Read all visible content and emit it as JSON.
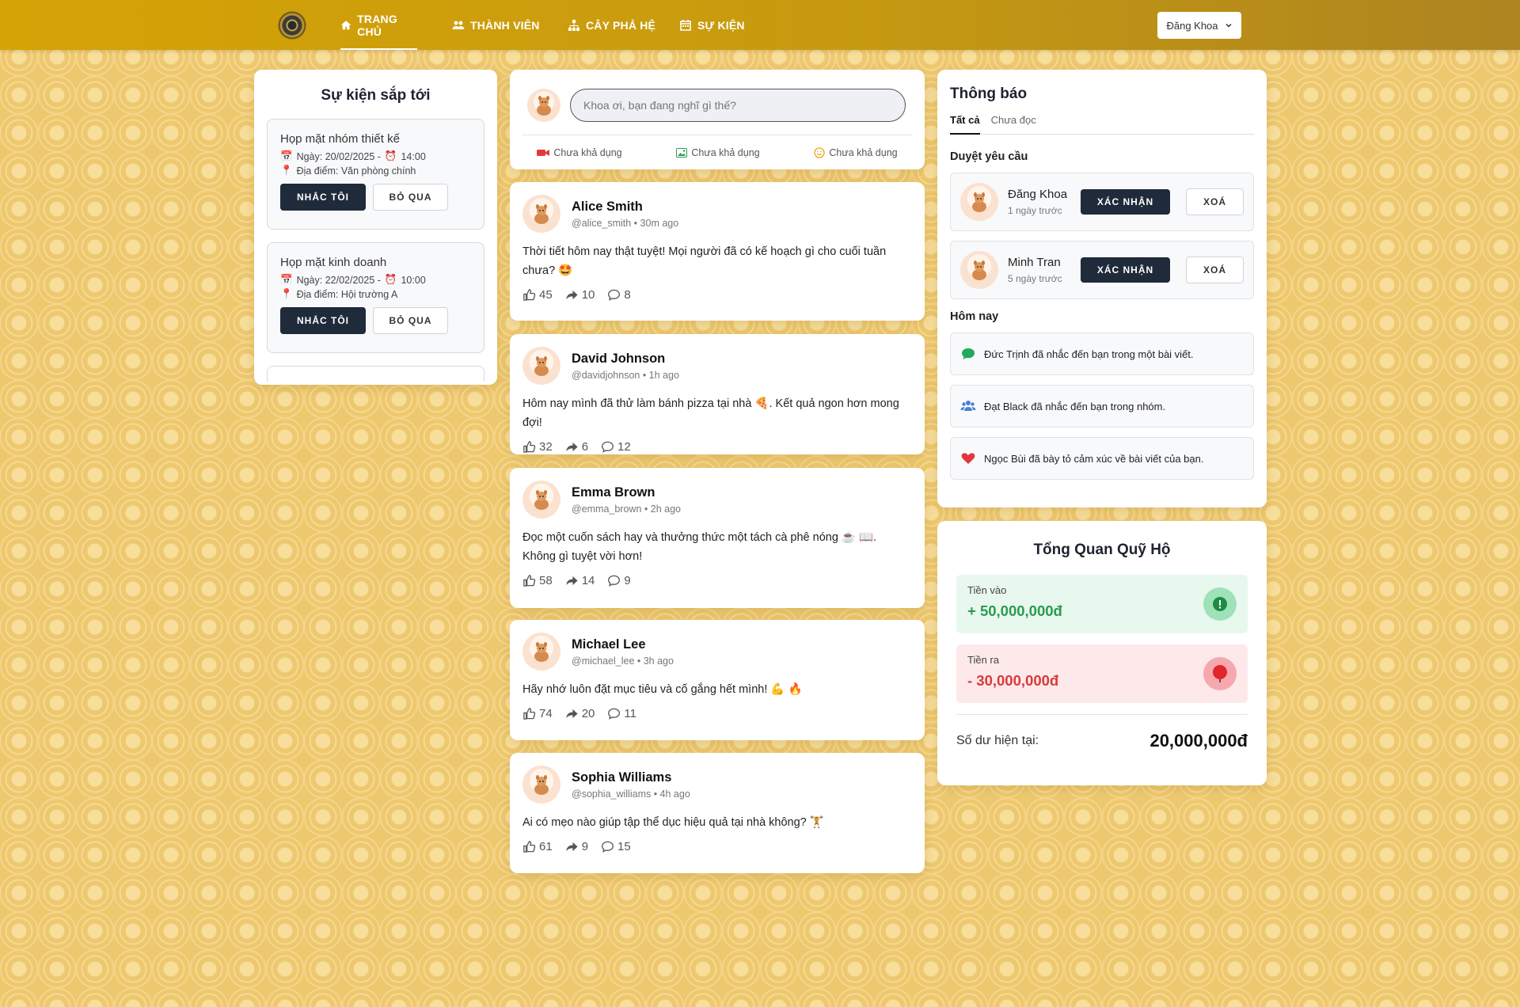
{
  "nav": {
    "items": [
      {
        "label": "TRANG CHỦ",
        "icon": "home-icon"
      },
      {
        "label": "THÀNH VIÊN",
        "icon": "users-icon"
      },
      {
        "label": "CÂY PHẢ HỆ",
        "icon": "sitemap-icon"
      },
      {
        "label": "SỰ KIỆN",
        "icon": "calendar-icon"
      }
    ],
    "user": "Đăng Khoa"
  },
  "events": {
    "title": "Sự kiện sắp tới",
    "items": [
      {
        "title": "Họp mặt nhóm thiết kế",
        "date": "Ngày: 20/02/2025 -",
        "time": "14:00",
        "location": "Địa điểm: Văn phòng chính",
        "remind": "NHẮC TÔI",
        "skip": "BỎ QUA"
      },
      {
        "title": "Họp mặt kinh doanh",
        "date": "Ngày: 22/02/2025 -",
        "time": "10:00",
        "location": "Địa điểm: Hội trường A",
        "remind": "NHẮC TÔI",
        "skip": "BỎ QUA"
      }
    ]
  },
  "composer": {
    "placeholder": "Khoa ơi, bạn đang nghĩ gì thế?",
    "actions": [
      "Chưa khả dụng",
      "Chưa khả dụng",
      "Chưa khả dụng"
    ]
  },
  "posts": [
    {
      "name": "Alice Smith",
      "meta": "@alice_smith • 30m ago",
      "body": "Thời tiết hôm nay thật tuyệt! Mọi người đã có kế hoạch gì cho cuối tuần chưa? 🤩",
      "likes": "45",
      "shares": "10",
      "comments": "8"
    },
    {
      "name": "David Johnson",
      "meta": "@davidjohnson • 1h ago",
      "body": "Hôm nay mình đã thử làm bánh pizza tại nhà 🍕. Kết quả ngon hơn mong đợi!",
      "likes": "32",
      "shares": "6",
      "comments": "12"
    },
    {
      "name": "Emma Brown",
      "meta": "@emma_brown • 2h ago",
      "body": "Đọc một cuốn sách hay và thưởng thức một tách cà phê nóng ☕ 📖. Không gì tuyệt vời hơn!",
      "likes": "58",
      "shares": "14",
      "comments": "9"
    },
    {
      "name": "Michael Lee",
      "meta": "@michael_lee • 3h ago",
      "body": "Hãy nhớ luôn đặt mục tiêu và cố gắng hết mình! 💪 🔥",
      "likes": "74",
      "shares": "20",
      "comments": "11"
    },
    {
      "name": "Sophia Williams",
      "meta": "@sophia_williams • 4h ago",
      "body": "Ai có mẹo nào giúp tập thể dục hiệu quả tại nhà không? 🏋️",
      "likes": "61",
      "shares": "9",
      "comments": "15"
    }
  ],
  "notifications": {
    "title": "Thông báo",
    "tabs": [
      "Tất cả",
      "Chưa đọc"
    ],
    "requests_label": "Duyệt yêu cầu",
    "requests": [
      {
        "name": "Đăng Khoa",
        "time": "1 ngày trước",
        "confirm": "XÁC NHẬN",
        "delete": "XOÁ"
      },
      {
        "name": "Minh Tran",
        "time": "5 ngày trước",
        "confirm": "XÁC NHẬN",
        "delete": "XOÁ"
      }
    ],
    "today_label": "Hôm nay",
    "today": [
      {
        "text": "Đức Trịnh đã nhắc đến bạn trong một bài viết.",
        "icon": "comment-icon",
        "color": "#22a861"
      },
      {
        "text": "Đạt Black đã nhắc đến bạn trong nhóm.",
        "icon": "users-icon",
        "color": "#4a7fd9"
      },
      {
        "text": "Ngọc Bùi đã bày tỏ cảm xúc về bài viết của bạn.",
        "icon": "heart-icon",
        "color": "#e0383e"
      }
    ]
  },
  "fund": {
    "title": "Tổng Quan Quỹ Hộ",
    "income_label": "Tiền vào",
    "income": "+ 50,000,000đ",
    "expense_label": "Tiền ra",
    "expense": "- 30,000,000đ",
    "balance_label": "Số dư hiện tại:",
    "balance": "20,000,000đ"
  }
}
